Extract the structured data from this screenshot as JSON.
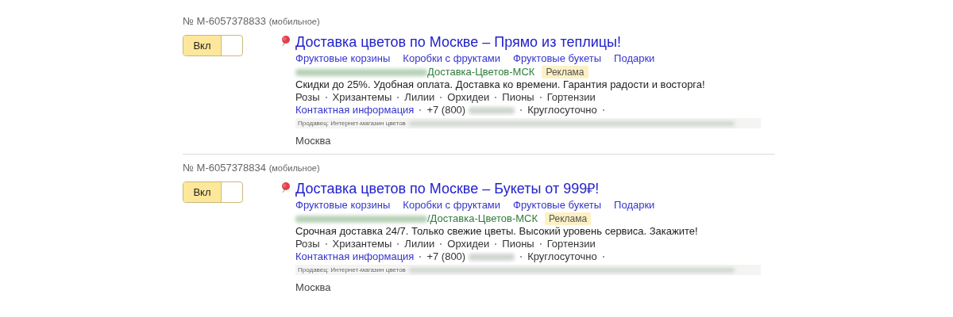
{
  "ads": [
    {
      "number": "№ M-6057378833",
      "device": "(мобильное)",
      "toggle": {
        "label": "Вкл",
        "on": true
      },
      "title": "Доставка цветов по Москве – Прямо из теплицы!",
      "sitelinks": [
        "Фруктовые корзины",
        "Коробки с фруктами",
        "Фруктовые букеты",
        "Подарки"
      ],
      "display_path": "Доставка-Цветов-МСК",
      "ad_label": "Реклама",
      "description": "Скидки до 25%. Удобная оплата. Доставка ко времени. Гарантия радости и восторга!",
      "tags": [
        "Розы",
        "Хризантемы",
        "Лилии",
        "Орхидеи",
        "Пионы",
        "Гортензии"
      ],
      "contact": {
        "link": "Контактная информация",
        "phone": "+7 (800)",
        "hours": "Круглосуточно"
      },
      "seller": "Продавец: Интернет-магазин цветов",
      "region": "Москва"
    },
    {
      "number": "№ M-6057378834",
      "device": "(мобильное)",
      "toggle": {
        "label": "Вкл",
        "on": true
      },
      "title": "Доставка цветов по Москве – Букеты от 999₽!",
      "sitelinks": [
        "Фруктовые корзины",
        "Коробки с фруктами",
        "Фруктовые букеты",
        "Подарки"
      ],
      "display_path": "/Доставка-Цветов-МСК",
      "ad_label": "Реклама",
      "description": "Срочная доставка 24/7. Только свежие цветы. Высокий уровень сервиса. Закажите!",
      "tags": [
        "Розы",
        "Хризантемы",
        "Лилии",
        "Орхидеи",
        "Пионы",
        "Гортензии"
      ],
      "contact": {
        "link": "Контактная информация",
        "phone": "+7 (800)",
        "hours": "Круглосуточно"
      },
      "seller": "Продавец: Интернет-магазин цветов",
      "region": "Москва"
    }
  ]
}
